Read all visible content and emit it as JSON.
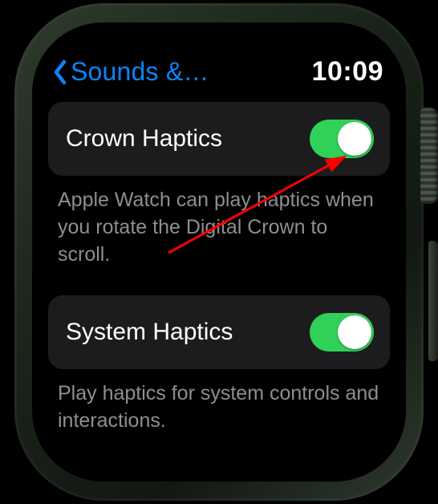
{
  "status": {
    "back_title": "Sounds &…",
    "time": "10:09"
  },
  "settings": [
    {
      "title": "Crown Haptics",
      "enabled": true,
      "footer": "Apple Watch can play hap­tics when you rotate the Digital Crown to scroll."
    },
    {
      "title": "System Haptics",
      "enabled": true,
      "footer": "Play haptics for system controls and interactions."
    }
  ],
  "colors": {
    "accent_blue": "#0a84ff",
    "toggle_green": "#30d158",
    "cell_bg": "#1c1c1e",
    "secondary_text": "#8e8e93",
    "annotation_red": "#ff0000"
  }
}
